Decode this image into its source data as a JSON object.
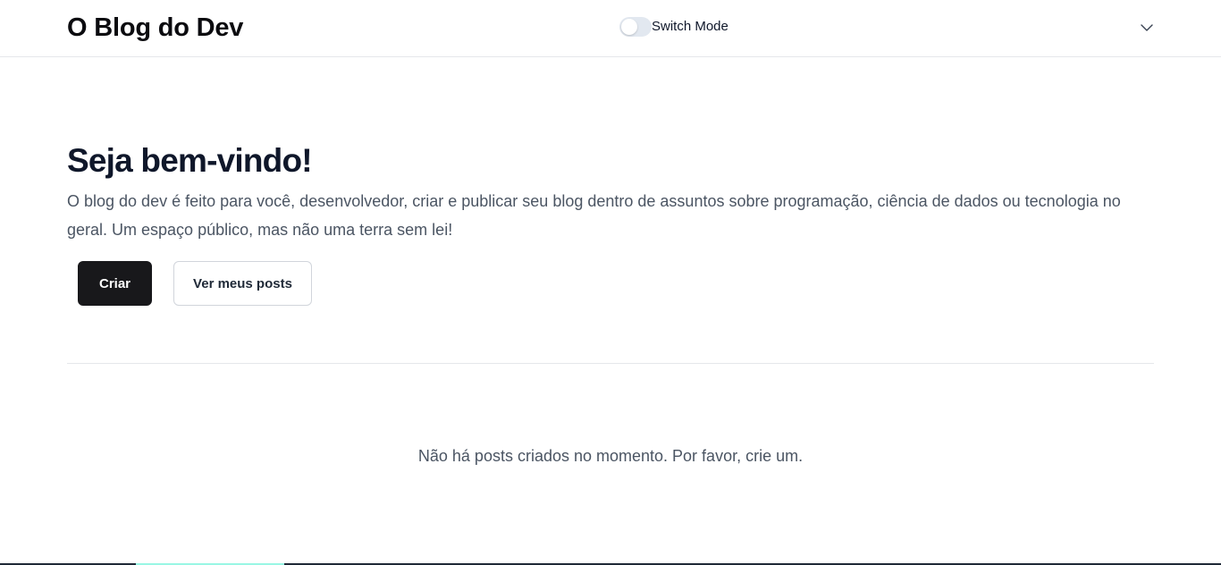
{
  "header": {
    "brand": "O Blog do Dev",
    "mode_switch_label": "Switch Mode",
    "menu_icon": "chevron-down-icon"
  },
  "hero": {
    "title": "Seja bem-vindo!",
    "description": "O blog do dev é feito para você, desenvolvedor, criar e publicar seu blog dentro de assuntos sobre programação, ciência de dados ou tecnologia no geral. Um espaço público, mas não uma terra sem lei!",
    "create_button": "Criar",
    "my_posts_button": "Ver meus posts"
  },
  "posts": {
    "empty_message": "Não há posts criados no momento. Por favor, crie um."
  },
  "colors": {
    "primary_button": "#18181b",
    "text_muted": "#4b5563",
    "border": "#e5e7eb"
  }
}
